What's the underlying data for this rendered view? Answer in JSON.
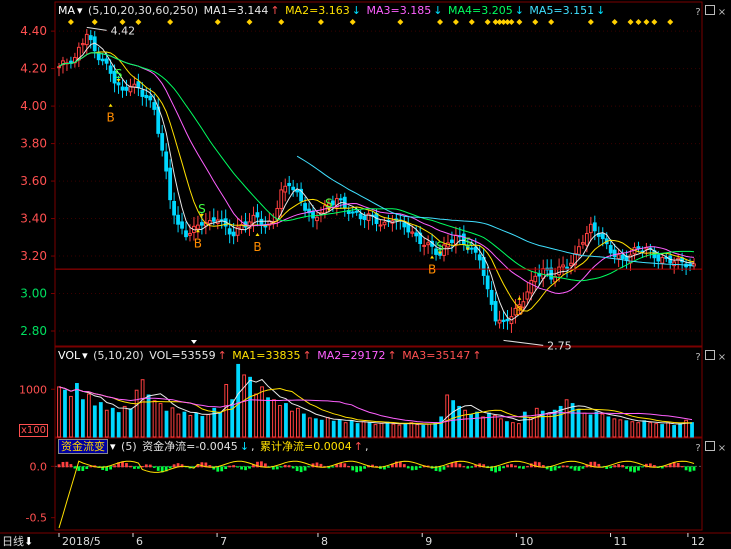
{
  "main_header": {
    "indicator": "MA",
    "params": "(5,10,20,30,60,250)",
    "ma1": "MA1=3.144",
    "ma2": "MA2=3.163",
    "ma3": "MA3=3.185",
    "ma4": "MA4=3.205",
    "ma5": "MA5=3.151",
    "arrow_up": "↑",
    "arrow_down": "↓"
  },
  "vol_header": {
    "indicator": "VOL",
    "params": "(5,10,20)",
    "vol": "VOL=53559",
    "ma1": "MA1=33835",
    "ma2": "MA2=29172",
    "ma3": "MA3=35147",
    "unit": "x100"
  },
  "flow_header": {
    "indicator": "资金流变",
    "params": "(5)",
    "net": "资金净流=-0.0045",
    "cum": "累计净流=0.0004",
    "comma": ","
  },
  "panel_controls": [
    "?",
    "□",
    "×"
  ],
  "period_label": "日线",
  "colors": {
    "up": "#ff4040",
    "down": "#00d8ff",
    "ma5": "#e8e8e8",
    "ma10": "#ffe000",
    "ma20": "#ff60ff",
    "ma30": "#00ff60",
    "ma60": "#40e0ff",
    "grid": "#7a0000",
    "axis_text": "#ff5050"
  },
  "chart_data": [
    {
      "type": "candlestick",
      "panel": "price",
      "y_ticks": [
        4.4,
        4.2,
        4.0,
        3.8,
        3.6,
        3.4,
        3.2,
        3.0,
        2.8
      ],
      "ylim": [
        2.72,
        4.47
      ],
      "x_tick_labels": [
        "2018/5",
        "6",
        "7",
        "8",
        "9",
        "10",
        "11",
        "12"
      ],
      "annotations": [
        {
          "text": "4.42",
          "value": 4.42
        },
        {
          "text": "2.75",
          "value": 2.75
        }
      ],
      "signals": [
        {
          "text": "S",
          "price": 4.15
        },
        {
          "text": "B",
          "price": 3.97
        },
        {
          "text": "S",
          "price": 3.43
        },
        {
          "text": "B",
          "price": 3.3
        },
        {
          "text": "B",
          "price": 3.28
        },
        {
          "text": "S",
          "price": 3.46
        },
        {
          "text": "B",
          "price": 3.16
        },
        {
          "text": "S",
          "price": 3.23
        },
        {
          "text": "B",
          "price": 2.94
        },
        {
          "text": "S",
          "price": 3.25
        }
      ],
      "current_price": 3.13,
      "close_path": [
        [
          0,
          4.21
        ],
        [
          4,
          4.24
        ],
        [
          7,
          4.4
        ],
        [
          9,
          4.3
        ],
        [
          11,
          4.25
        ],
        [
          14,
          4.13
        ],
        [
          16,
          4.06
        ],
        [
          18,
          4.12
        ],
        [
          20,
          4.1
        ],
        [
          22,
          4.06
        ],
        [
          24,
          3.98
        ],
        [
          26,
          3.75
        ],
        [
          28,
          3.5
        ],
        [
          30,
          3.36
        ],
        [
          32,
          3.33
        ],
        [
          34,
          3.35
        ],
        [
          36,
          3.38
        ],
        [
          38,
          3.36
        ],
        [
          40,
          3.4
        ],
        [
          42,
          3.35
        ],
        [
          44,
          3.33
        ],
        [
          46,
          3.37
        ],
        [
          48,
          3.38
        ],
        [
          50,
          3.4
        ],
        [
          52,
          3.34
        ],
        [
          54,
          3.4
        ],
        [
          56,
          3.55
        ],
        [
          58,
          3.6
        ],
        [
          60,
          3.52
        ],
        [
          62,
          3.45
        ],
        [
          64,
          3.38
        ],
        [
          66,
          3.45
        ],
        [
          68,
          3.48
        ],
        [
          70,
          3.52
        ],
        [
          72,
          3.45
        ],
        [
          74,
          3.42
        ],
        [
          76,
          3.4
        ],
        [
          78,
          3.42
        ],
        [
          80,
          3.4
        ],
        [
          82,
          3.37
        ],
        [
          84,
          3.4
        ],
        [
          86,
          3.36
        ],
        [
          88,
          3.34
        ],
        [
          90,
          3.3
        ],
        [
          92,
          3.28
        ],
        [
          94,
          3.25
        ],
        [
          96,
          3.2
        ],
        [
          98,
          3.26
        ],
        [
          100,
          3.3
        ],
        [
          102,
          3.28
        ],
        [
          104,
          3.24
        ],
        [
          106,
          3.2
        ],
        [
          108,
          3.0
        ],
        [
          110,
          2.86
        ],
        [
          112,
          2.83
        ],
        [
          114,
          2.9
        ],
        [
          116,
          2.94
        ],
        [
          118,
          3.02
        ],
        [
          120,
          3.08
        ],
        [
          122,
          3.12
        ],
        [
          124,
          3.08
        ],
        [
          126,
          3.14
        ],
        [
          128,
          3.16
        ],
        [
          130,
          3.2
        ],
        [
          132,
          3.28
        ],
        [
          134,
          3.34
        ],
        [
          136,
          3.32
        ],
        [
          138,
          3.26
        ],
        [
          140,
          3.22
        ],
        [
          142,
          3.18
        ],
        [
          144,
          3.2
        ],
        [
          146,
          3.23
        ],
        [
          148,
          3.24
        ],
        [
          150,
          3.21
        ],
        [
          152,
          3.19
        ],
        [
          154,
          3.18
        ],
        [
          156,
          3.16
        ],
        [
          158,
          3.15
        ],
        [
          160,
          3.14
        ]
      ]
    },
    {
      "type": "bar",
      "panel": "volume",
      "y_ticks": [
        1000
      ],
      "ymax": 1550,
      "values": [
        1050,
        980,
        850,
        1120,
        780,
        900,
        650,
        720,
        560,
        600,
        510,
        640,
        590,
        980,
        1200,
        880,
        760,
        700,
        540,
        610,
        480,
        520,
        450,
        500,
        430,
        470,
        600,
        520,
        1100,
        780,
        1520,
        1300,
        1250,
        900,
        1050,
        820,
        780,
        660,
        700,
        540,
        600,
        480,
        400,
        380,
        350,
        410,
        330,
        360,
        300,
        340,
        280,
        320,
        300,
        260,
        290,
        310,
        270,
        250,
        280,
        300,
        260,
        240,
        270,
        300,
        420,
        880,
        760,
        640,
        560,
        470,
        520,
        420,
        500,
        450,
        380,
        320,
        300,
        280,
        520,
        400,
        600,
        540,
        480,
        560,
        640,
        780,
        700,
        580,
        500,
        460,
        520,
        480,
        420,
        380,
        360,
        340,
        320,
        300,
        340,
        300,
        280,
        260,
        300,
        240,
        280,
        350,
        300
      ]
    },
    {
      "type": "bar",
      "panel": "fund_flow",
      "y_ticks": [
        0.0,
        -0.5
      ],
      "ylim": [
        -0.62,
        0.12
      ],
      "line_label": "累计净流"
    }
  ]
}
